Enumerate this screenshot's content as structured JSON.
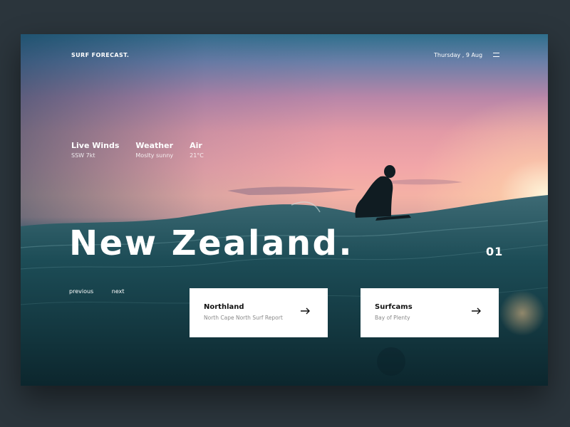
{
  "header": {
    "brand": "SURF FORECAST.",
    "date": "Thursday , 9 Aug"
  },
  "conditions": [
    {
      "label": "Live Winds",
      "value": "SSW 7kt"
    },
    {
      "label": "Weather",
      "value": "Moslty sunny"
    },
    {
      "label": "Air",
      "value": "21°C"
    }
  ],
  "hero": {
    "title": "New Zealand.",
    "slide_number": "01"
  },
  "pager": {
    "previous": "previous",
    "next": "next"
  },
  "cards": [
    {
      "title": "Northland",
      "subtitle": "North Cape North Surf Report",
      "icon": "arrow-right-icon"
    },
    {
      "title": "Surfcams",
      "subtitle": "Bay of Plenty",
      "icon": "arrow-right-icon"
    }
  ],
  "colors": {
    "page_background": "#2b353c",
    "card_background": "#ffffff",
    "sky_pink": "#f2a6a8",
    "sea_dark": "#12363f"
  }
}
